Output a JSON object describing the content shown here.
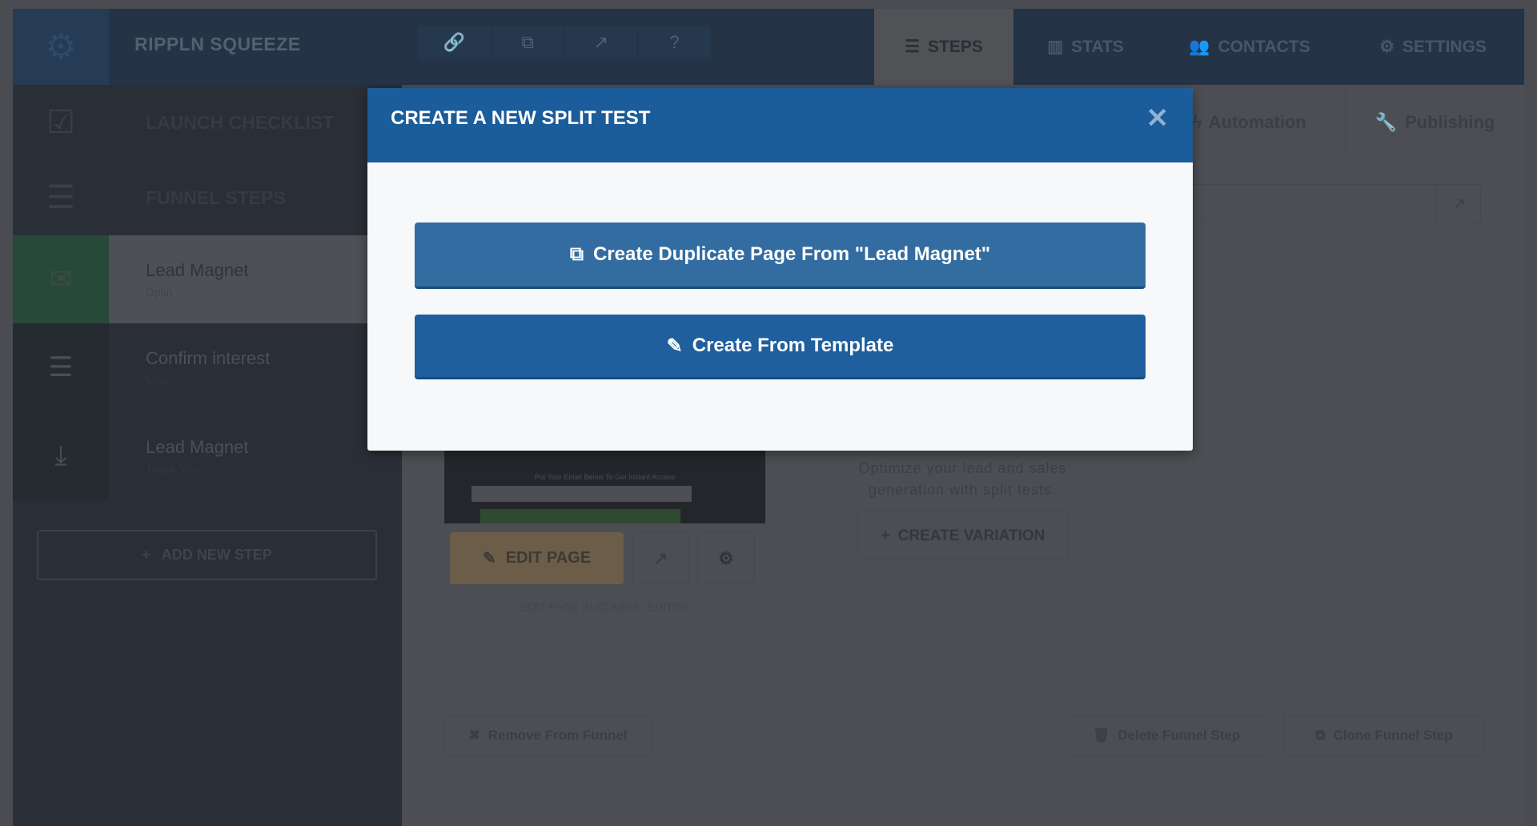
{
  "header": {
    "brand": "RIPPLN SQUEEZE",
    "tools": [
      {
        "icon": "link-icon",
        "g": "🔗"
      },
      {
        "icon": "copy-icon",
        "g": "⧉"
      },
      {
        "icon": "external-link-icon",
        "g": "↗"
      },
      {
        "icon": "help-icon",
        "g": "?"
      }
    ],
    "nav": [
      {
        "label": "STEPS",
        "icon": "☰"
      },
      {
        "label": "STATS",
        "icon": "▥"
      },
      {
        "label": "CONTACTS",
        "icon": "👥"
      },
      {
        "label": "SETTINGS",
        "icon": "⚙"
      }
    ]
  },
  "sidebar": {
    "launch_checklist": "LAUNCH CHECKLIST",
    "funnel_steps": "FUNNEL STEPS",
    "steps": [
      {
        "name": "Lead Magnet",
        "type": "Optin",
        "icon": "envelope-icon"
      },
      {
        "name": "Confirm interest",
        "type": "Misc",
        "icon": "list-icon"
      },
      {
        "name": "Lead Magnet",
        "type": "Thank You",
        "icon": "download-icon"
      }
    ],
    "add_step": "ADD NEW STEP"
  },
  "main": {
    "tabs": [
      "Automation",
      "Publishing"
    ],
    "thumbnail_text": "Put Your Email Below To Get Instant Access",
    "edit_page": "EDIT PAGE",
    "classic_editor": "EDIT PAGE IN CLASSIC EDITOR",
    "split_text_1": "Optimize your lead and sales",
    "split_text_2": "generation with split tests.",
    "create_variation": "CREATE VARIATION",
    "remove": "Remove From Funnel",
    "delete": "Delete Funnel Step",
    "clone": "Clone Funnel Step"
  },
  "modal": {
    "title": "CREATE A NEW SPLIT TEST",
    "close": "✕",
    "duplicate": "Create Duplicate Page From \"Lead Magnet\"",
    "template": "Create From Template"
  },
  "colors": {
    "modal_header": "#1b5c9a",
    "duplicate_button": "#336ca0",
    "template_button": "#1f5f9e"
  }
}
